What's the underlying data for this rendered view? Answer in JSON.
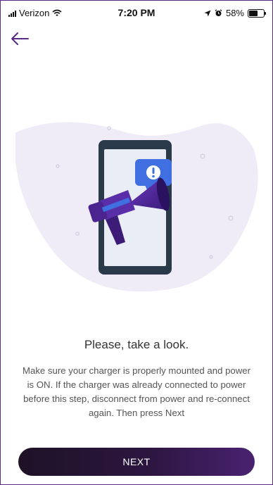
{
  "status_bar": {
    "carrier": "Verizon",
    "time": "7:20 PM",
    "battery_percent": "58%",
    "battery_level": 0.58,
    "icons": [
      "signal-icon",
      "wifi-icon",
      "location-arrow-icon",
      "alarm-icon",
      "battery-icon"
    ]
  },
  "nav": {
    "back_icon": "arrow-left-icon"
  },
  "illustration": {
    "icon": "megaphone-phone-illustration",
    "badge_text": "!"
  },
  "content": {
    "title": "Please, take a look.",
    "description": "Make sure your charger is properly mounted and power is ON. If the charger was already connected to power before this step, disconnect from power and re-connect again. Then press Next"
  },
  "actions": {
    "next_label": "NEXT"
  },
  "colors": {
    "accent": "#5a2a86",
    "button_dark": "#1e1226",
    "button_light": "#4a2270",
    "blob": "#efecf8",
    "badge": "#3f6fe0"
  }
}
